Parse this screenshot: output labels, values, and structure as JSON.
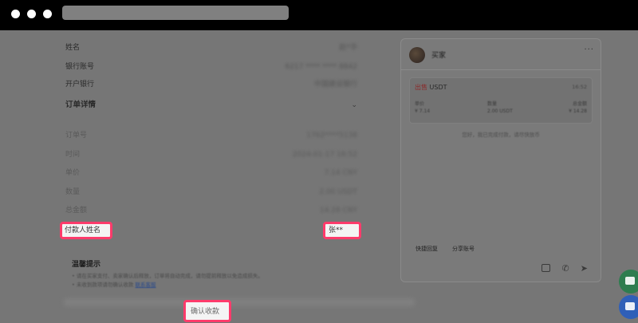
{
  "details": {
    "name_label": "姓名",
    "name_value": "赵*华",
    "account_label": "银行账号",
    "account_value": "6217 ****  **** 8842",
    "bank_label": "开户银行",
    "bank_value": "中国建设银行",
    "order_section": "订单详情",
    "order_no_label": "订单号",
    "order_no_value": "1762****5138",
    "time_label": "时间",
    "time_value": "2024-01-17 16:52",
    "price_label": "单价",
    "price_value": "7.14 CNY",
    "qty_label": "数量",
    "qty_value": "2.00 USDT",
    "total_label": "总金额",
    "total_value": "14.28 CNY"
  },
  "highlights": {
    "payer_label": "付款人姓名",
    "payer_value": "张**",
    "confirm_button": "确认收款"
  },
  "tips": {
    "title": "温馨提示",
    "line1": "• 请在买家支付、卖家确认后释放，订单将自动完成，请勿提前释放以免造成损失。",
    "line2": "• 未收到款项请勿确认收款",
    "link": "联系客服"
  },
  "chat": {
    "name": "买家",
    "more": "···",
    "card_side": "出售",
    "card_coin": "USDT",
    "card_time": "16:52",
    "col1_label": "单价",
    "col1_value": "¥ 7.14",
    "col2_label": "数量",
    "col2_value": "2.00 USDT",
    "col3_label": "总金额",
    "col3_value": "¥ 14.28",
    "hint": "您好，我已完成付款，请尽快放币",
    "quick_reply": "快捷回复",
    "share_account": "分享账号"
  },
  "icons": {
    "image": "image-icon",
    "phone": "phone-icon",
    "send": "send-icon"
  }
}
